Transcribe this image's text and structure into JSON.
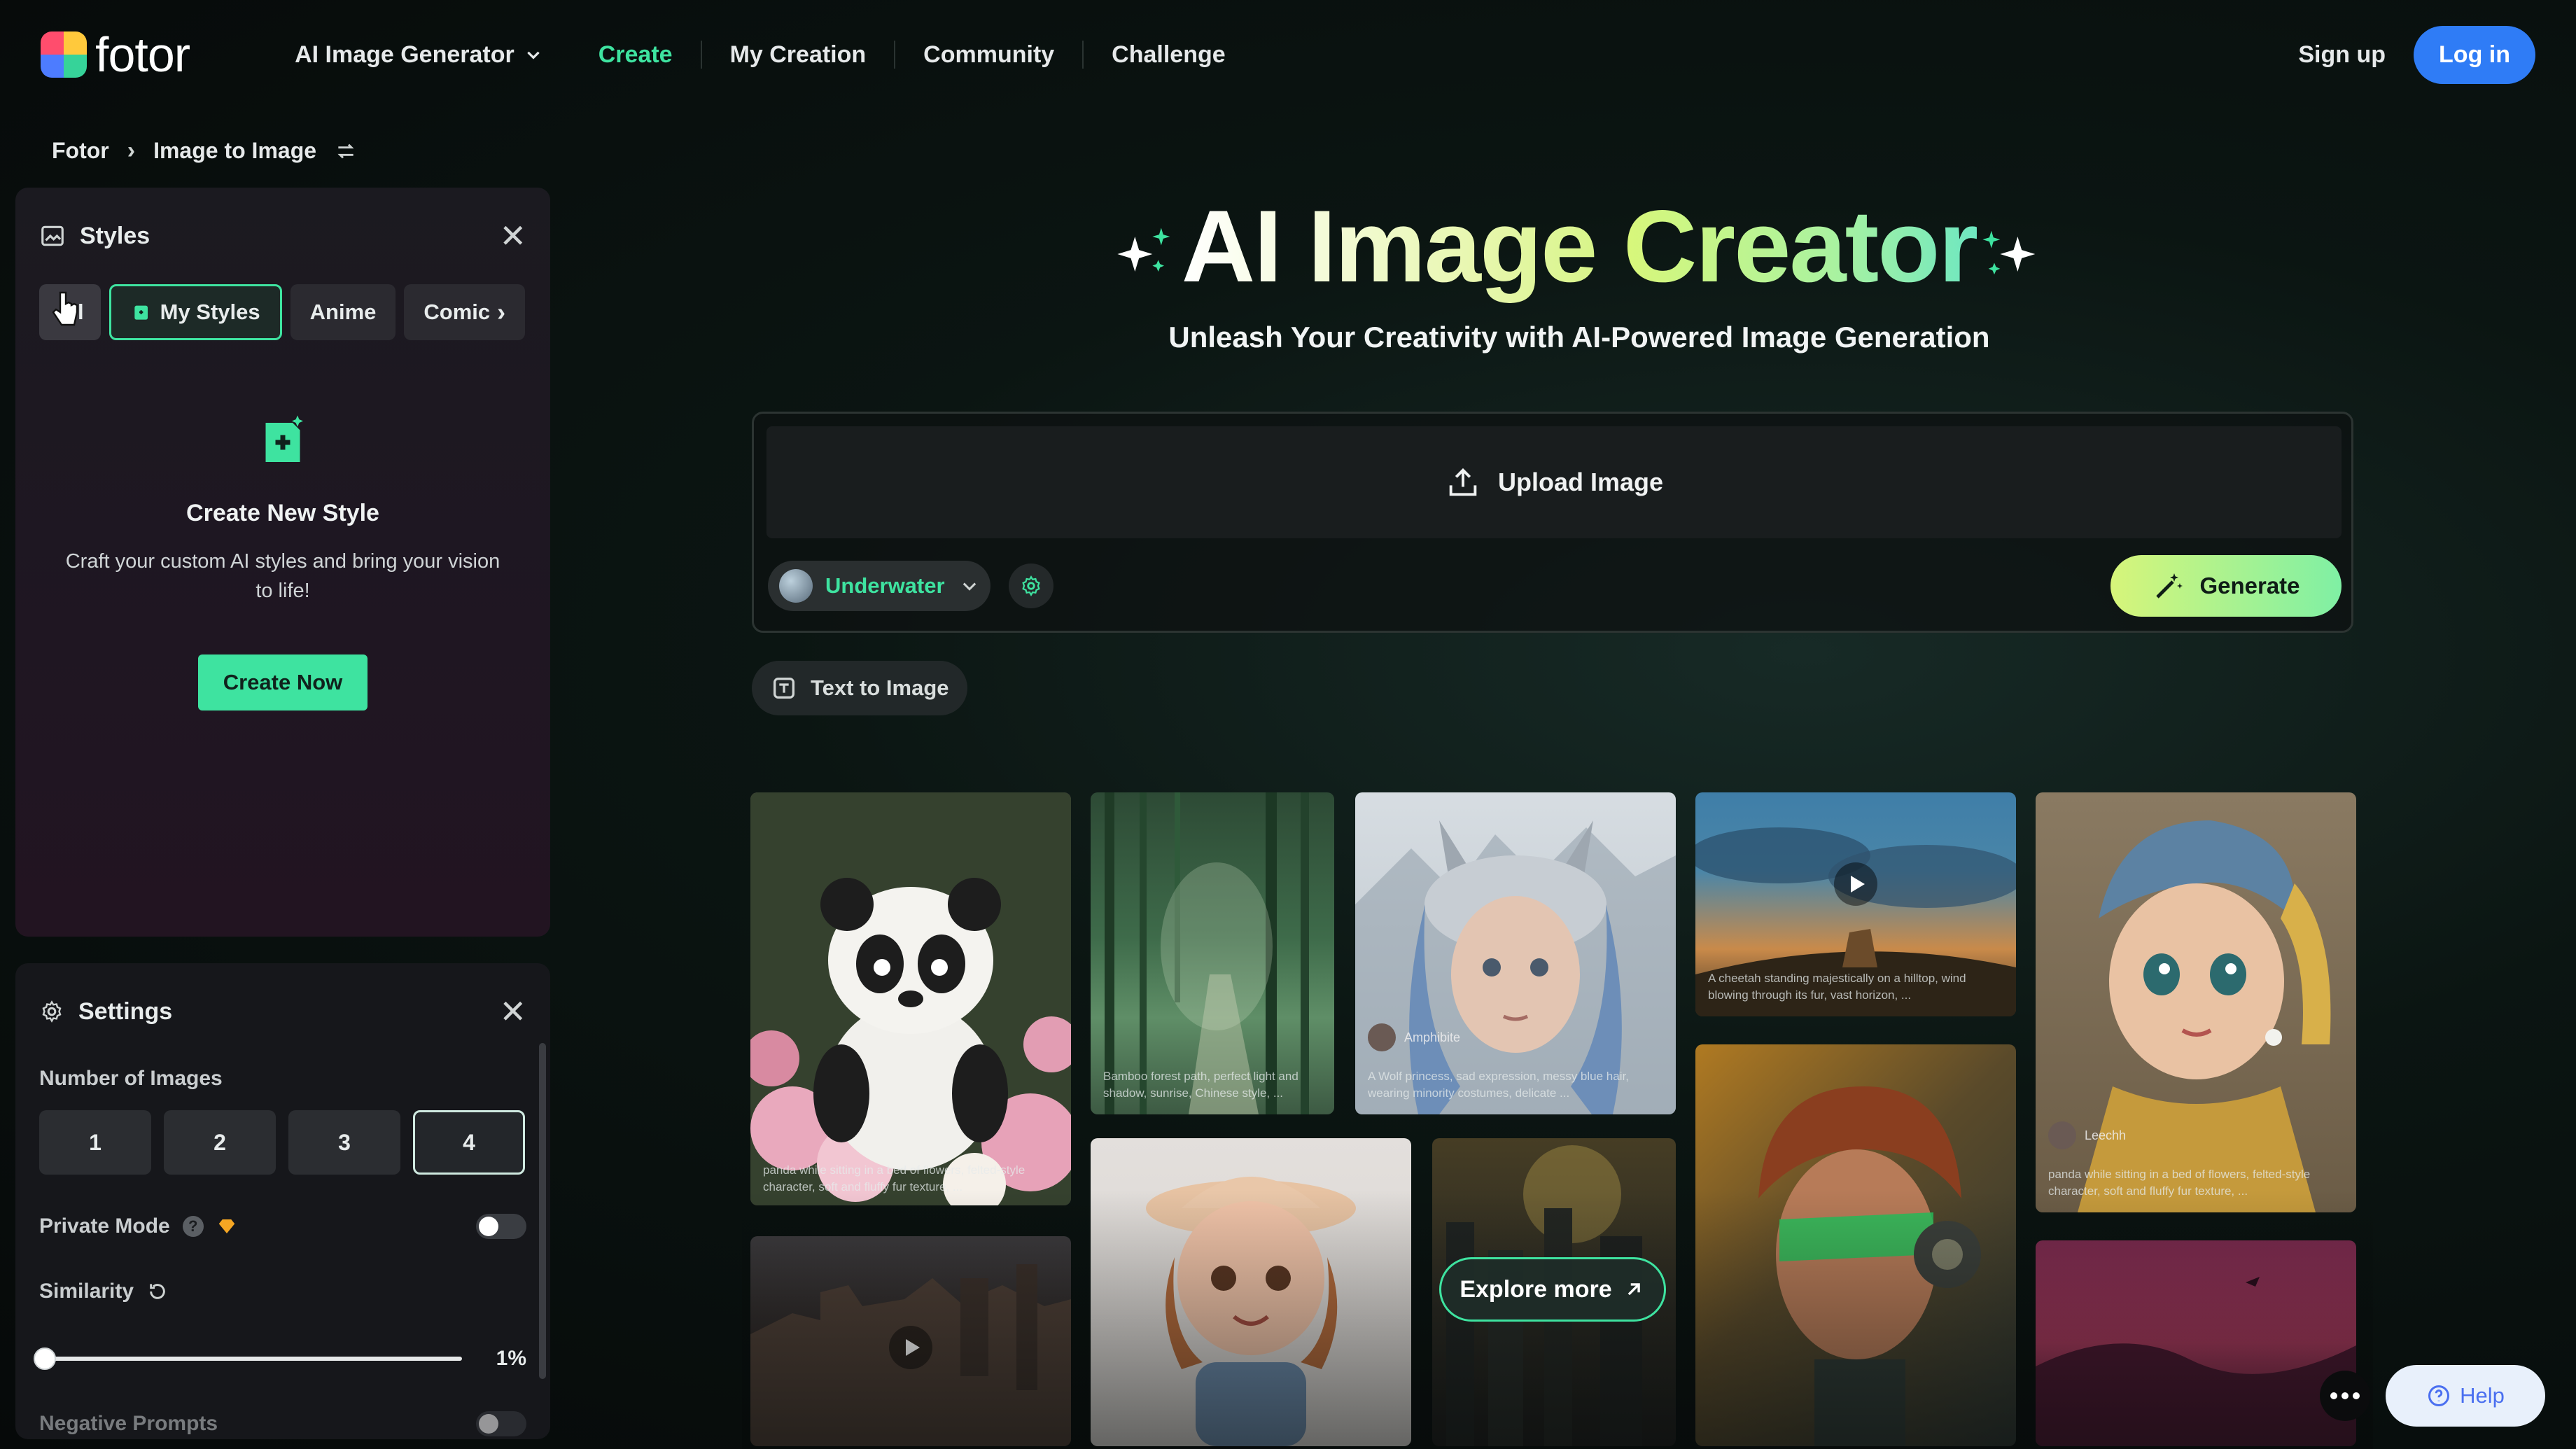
{
  "nav": {
    "logo": "fotor",
    "items": [
      {
        "label": "AI Image Generator",
        "dropdown": true
      },
      {
        "label": "Create",
        "active": true
      },
      {
        "label": "My Creation"
      },
      {
        "label": "Community"
      },
      {
        "label": "Challenge"
      }
    ],
    "signup": "Sign up",
    "login": "Log in"
  },
  "breadcrumb": {
    "root": "Fotor",
    "current": "Image to Image"
  },
  "styles_panel": {
    "title": "Styles",
    "chips": [
      "All",
      "My Styles",
      "Anime",
      "Comic"
    ],
    "selected_chip": "My Styles",
    "new_style_title": "Create New Style",
    "new_style_desc": "Craft your custom AI styles and bring your vision to life!",
    "create_button": "Create Now"
  },
  "settings_panel": {
    "title": "Settings",
    "num_images_label": "Number of Images",
    "num_options": [
      "1",
      "2",
      "3",
      "4"
    ],
    "num_selected": "4",
    "private_mode_label": "Private Mode",
    "private_mode_on": false,
    "similarity_label": "Similarity",
    "similarity_value": "1%",
    "similarity_level": 0.01,
    "negative_prompts_label": "Negative Prompts"
  },
  "hero": {
    "title_part1": "AI Image",
    "title_part2": "Creator",
    "subtitle": "Unleash Your Creativity with AI-Powered Image Generation"
  },
  "generator": {
    "upload_label": "Upload Image",
    "style_value": "Underwater",
    "generate_label": "Generate"
  },
  "text_to_image": "Text to Image",
  "gallery": {
    "captions": {
      "panda": "panda while sitting in a bed of flowers, felted-style character, soft and fluffy fur texture, ...",
      "bamboo": "Bamboo forest path, perfect light and shadow, sunrise, Chinese style, ...",
      "wolf_girl": "A Wolf princess, sad expression, messy blue hair, wearing minority costumes, delicate ...",
      "cheetah": "A cheetah standing majestically on a hilltop, wind blowing through its fur, vast horizon, ...",
      "pearl": "panda while sitting in a bed of flowers, felted-style character, soft and fluffy fur texture, ..."
    },
    "users": {
      "wolf_girl": "Amphibite",
      "pearl": "Leechh"
    },
    "explore_label": "Explore more"
  },
  "help_label": "Help",
  "colors": {
    "accent": "#3ee3a0",
    "login": "#2f7cf6"
  }
}
